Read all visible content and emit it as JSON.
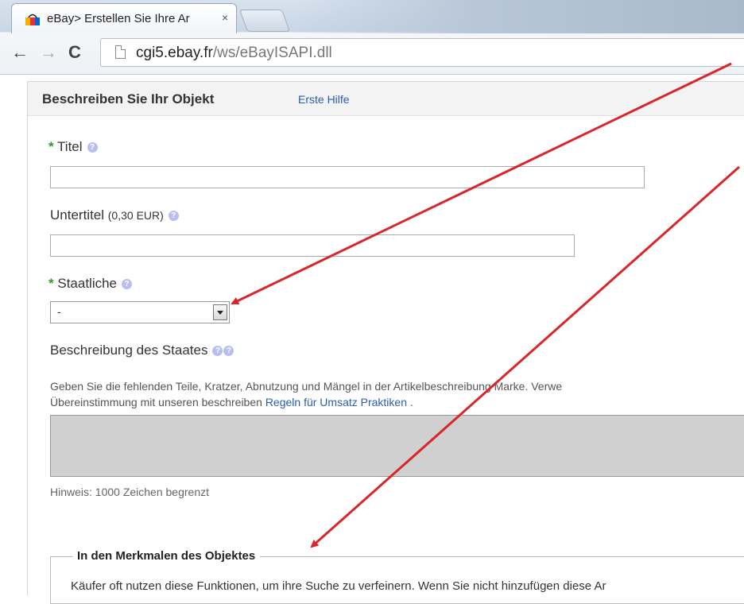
{
  "browser": {
    "tab_title": "eBay> Erstellen Sie Ihre Ar",
    "tab_close": "×",
    "url_host": "cgi5.ebay.fr",
    "url_path": "/ws/eBayISAPI.dll",
    "back_glyph": "←",
    "forward_glyph": "→",
    "reload_glyph": "C"
  },
  "header": {
    "title": "Beschreiben Sie Ihr Objekt",
    "help_link": "Erste Hilfe"
  },
  "form": {
    "required_mark": "*",
    "help_glyph": "?",
    "title_label": "Titel",
    "subtitle_label": "Untertitel",
    "subtitle_price": "(0,30 EUR)",
    "condition_label": "Staatliche",
    "condition_value": "-",
    "condition_desc_label": "Beschreibung des Staates",
    "condition_desc_text_1": "Geben Sie die fehlenden Teile, Kratzer, Abnutzung und Mängel in der Artikelbeschreibung Marke. Verwe",
    "condition_desc_text_2": "Übereinstimmung mit unseren beschreiben",
    "policy_link": "Regeln für Umsatz Praktiken",
    "condition_desc_text_3": ".",
    "hint": "Hinweis: 1000 Zeichen begrenzt"
  },
  "specifics": {
    "legend": "In den Merkmalen des Objektes",
    "text": "Käufer oft nutzen diese Funktionen, um ihre Suche zu verfeinern. Wenn Sie nicht hinzufügen diese Ar"
  },
  "colors": {
    "required": "#2f9a2f",
    "link": "#2a5db0",
    "arrow": "#d9262c"
  }
}
